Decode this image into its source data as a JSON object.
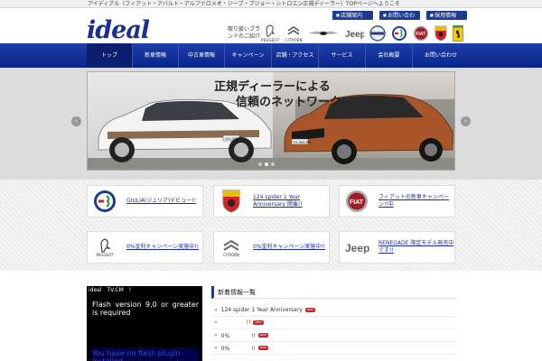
{
  "topbar": {
    "text": "アイディアル（フィアット・アバルト・アルファロメオ・ジープ・プジョー・シトロエン正規ディーラー）TOPページへようこそ"
  },
  "header": {
    "logo": "ideal",
    "util_links": [
      "店舗案内",
      "お問い合わせ",
      "採用情報"
    ],
    "brand_caption": "取り扱いブランドのご紹介",
    "brands": [
      {
        "icon": "peugeot-logo-icon",
        "wordmark": "PEUGEOT"
      },
      {
        "icon": "citroen-logo-icon",
        "wordmark": "CITROËN"
      },
      {
        "icon": "chrysler-logo-icon",
        "wordmark": ""
      },
      {
        "icon": "jeep-logo-icon",
        "wordmark": ""
      },
      {
        "icon": "volvo-logo-icon",
        "wordmark": ""
      },
      {
        "icon": "alfa-romeo-logo-icon",
        "wordmark": ""
      },
      {
        "icon": "fiat-logo-icon",
        "wordmark": ""
      },
      {
        "icon": "abarth-logo-icon",
        "wordmark": ""
      },
      {
        "icon": "ferrari-logo-icon",
        "wordmark": ""
      }
    ]
  },
  "nav": [
    "トップ",
    "新車情報",
    "中古車情報",
    "キャンペーン",
    "店舗・アクセス",
    "サービス",
    "会社概要",
    "お問い合わせ"
  ],
  "slider": {
    "caption_line1": "正規ディーラーによる",
    "caption_line2": "信頼のネットワーク",
    "prev": "‹",
    "next": "›",
    "plate_left": "GH-257-ZF",
    "plate_right": "TH-969-RR"
  },
  "cards": [
    {
      "brand": "ALFA ROMEO",
      "text": "GIULIA(ジュリア)デビュー!!"
    },
    {
      "brand": "ABARTH",
      "text": "124 spider 1 Year Anniversary 開催!!"
    },
    {
      "brand": "FIAT",
      "text": "フィアットの新車キャンペーン!!中"
    },
    {
      "brand": "PEUGEOT",
      "text": "0%金利キャンペーン実施中!!"
    },
    {
      "brand": "CITROËN",
      "text": "0%金利キャンペーン実施中!!"
    },
    {
      "brand": "Jeep",
      "text": "RENEGADE 限定モデル発売中です!!"
    }
  ],
  "video": {
    "title": "ideal　TV.CM　!",
    "flash_msg": "Flash version 9,0 or greater is required",
    "flash_link": "You have no flash plugin installed"
  },
  "news": {
    "title": "新着情報一覧",
    "items": [
      {
        "text": "124 spider 1 Year Anniversary",
        "badge": "NEW"
      },
      {
        "text": "!!",
        "badge": "NEW"
      },
      {
        "text": "0%　　　　!!",
        "badge": "NEW"
      },
      {
        "text": "0%　　　　!!",
        "badge": "NEW"
      }
    ]
  },
  "colors": {
    "brand_blue": "#1d2e8f",
    "nav_blue": "#0a238c",
    "badge_red": "#d42020"
  }
}
